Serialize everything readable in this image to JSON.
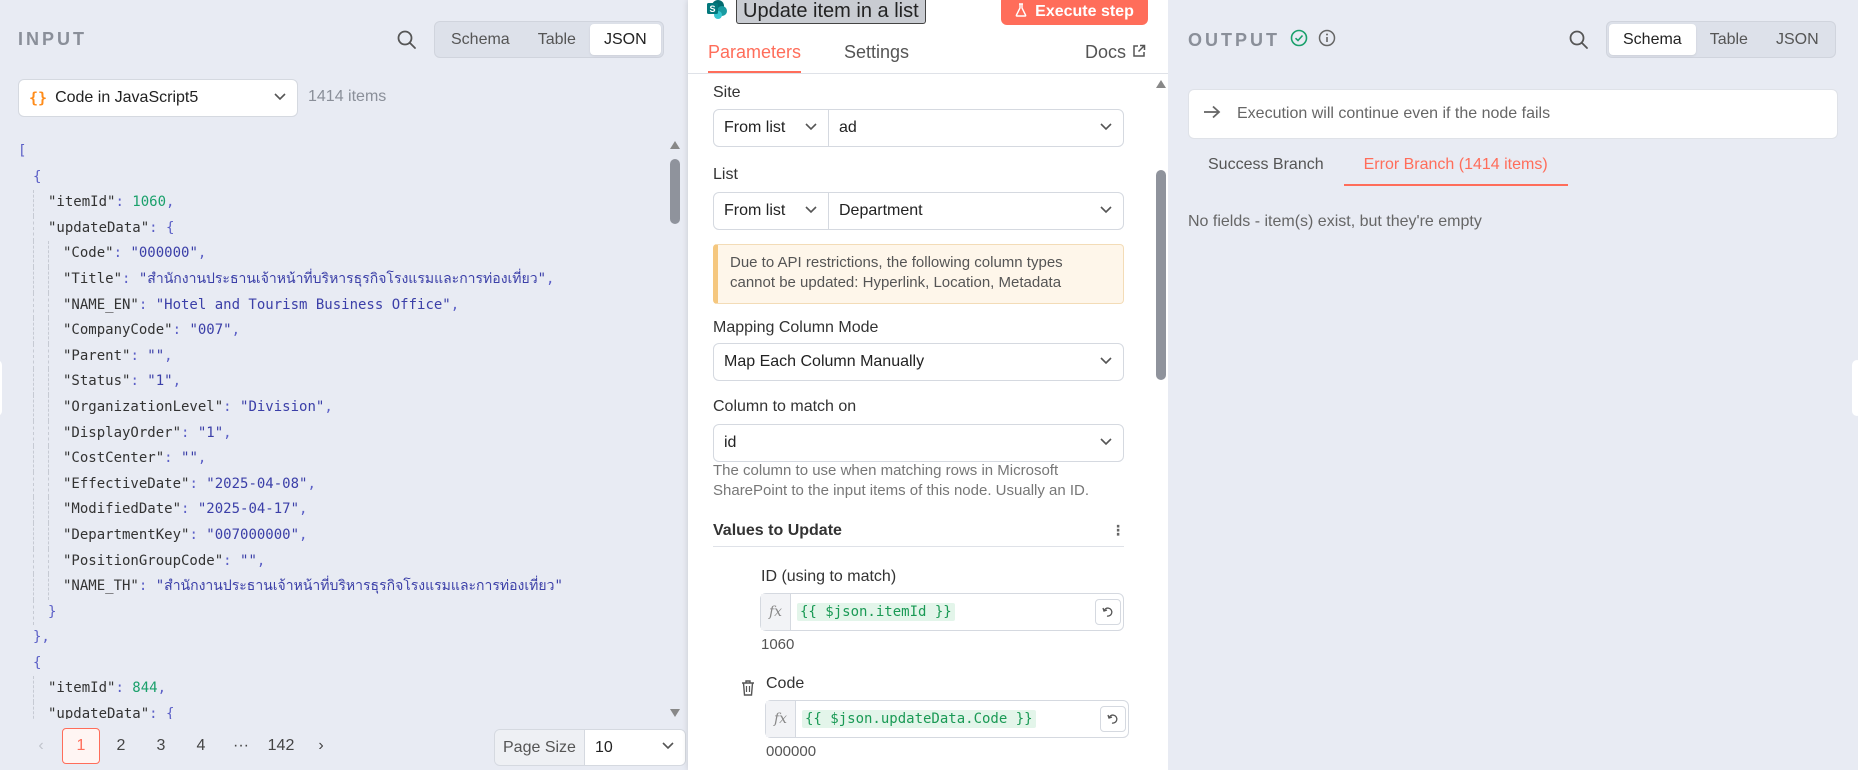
{
  "input": {
    "title": "INPUT",
    "view_tabs": [
      "Schema",
      "Table",
      "JSON"
    ],
    "active_view": "JSON",
    "node_select": "Code in JavaScript5",
    "items_count": "1414 items",
    "json_lines": [
      {
        "indent": 0,
        "parts": [
          [
            "pun",
            "["
          ]
        ]
      },
      {
        "indent": 1,
        "parts": [
          [
            "pun",
            "{"
          ]
        ]
      },
      {
        "indent": 2,
        "parts": [
          [
            "key",
            "\"itemId\""
          ],
          [
            "pun",
            ": "
          ],
          [
            "num",
            "1060"
          ],
          [
            "pun",
            ","
          ]
        ]
      },
      {
        "indent": 2,
        "parts": [
          [
            "key",
            "\"updateData\""
          ],
          [
            "pun",
            ": {"
          ]
        ]
      },
      {
        "indent": 3,
        "parts": [
          [
            "key",
            "\"Code\""
          ],
          [
            "pun",
            ": "
          ],
          [
            "str",
            "\"000000\""
          ],
          [
            "pun",
            ","
          ]
        ]
      },
      {
        "indent": 3,
        "parts": [
          [
            "key",
            "\"Title\""
          ],
          [
            "pun",
            ": "
          ],
          [
            "str",
            "\"สำนักงานประธานเจ้าหน้าที่บริหารธุรกิจโรงแรมและการท่องเที่ยว\""
          ],
          [
            "pun",
            ","
          ]
        ]
      },
      {
        "indent": 3,
        "parts": [
          [
            "key",
            "\"NAME_EN\""
          ],
          [
            "pun",
            ": "
          ],
          [
            "str",
            "\"Hotel and Tourism Business Office\""
          ],
          [
            "pun",
            ","
          ]
        ]
      },
      {
        "indent": 3,
        "parts": [
          [
            "key",
            "\"CompanyCode\""
          ],
          [
            "pun",
            ": "
          ],
          [
            "str",
            "\"007\""
          ],
          [
            "pun",
            ","
          ]
        ]
      },
      {
        "indent": 3,
        "parts": [
          [
            "key",
            "\"Parent\""
          ],
          [
            "pun",
            ": "
          ],
          [
            "str",
            "\"\""
          ],
          [
            "pun",
            ","
          ]
        ]
      },
      {
        "indent": 3,
        "parts": [
          [
            "key",
            "\"Status\""
          ],
          [
            "pun",
            ": "
          ],
          [
            "str",
            "\"1\""
          ],
          [
            "pun",
            ","
          ]
        ]
      },
      {
        "indent": 3,
        "parts": [
          [
            "key",
            "\"OrganizationLevel\""
          ],
          [
            "pun",
            ": "
          ],
          [
            "str",
            "\"Division\""
          ],
          [
            "pun",
            ","
          ]
        ]
      },
      {
        "indent": 3,
        "parts": [
          [
            "key",
            "\"DisplayOrder\""
          ],
          [
            "pun",
            ": "
          ],
          [
            "str",
            "\"1\""
          ],
          [
            "pun",
            ","
          ]
        ]
      },
      {
        "indent": 3,
        "parts": [
          [
            "key",
            "\"CostCenter\""
          ],
          [
            "pun",
            ": "
          ],
          [
            "str",
            "\"\""
          ],
          [
            "pun",
            ","
          ]
        ]
      },
      {
        "indent": 3,
        "parts": [
          [
            "key",
            "\"EffectiveDate\""
          ],
          [
            "pun",
            ": "
          ],
          [
            "str",
            "\"2025-04-08\""
          ],
          [
            "pun",
            ","
          ]
        ]
      },
      {
        "indent": 3,
        "parts": [
          [
            "key",
            "\"ModifiedDate\""
          ],
          [
            "pun",
            ": "
          ],
          [
            "str",
            "\"2025-04-17\""
          ],
          [
            "pun",
            ","
          ]
        ]
      },
      {
        "indent": 3,
        "parts": [
          [
            "key",
            "\"DepartmentKey\""
          ],
          [
            "pun",
            ": "
          ],
          [
            "str",
            "\"007000000\""
          ],
          [
            "pun",
            ","
          ]
        ]
      },
      {
        "indent": 3,
        "parts": [
          [
            "key",
            "\"PositionGroupCode\""
          ],
          [
            "pun",
            ": "
          ],
          [
            "str",
            "\"\""
          ],
          [
            "pun",
            ","
          ]
        ]
      },
      {
        "indent": 3,
        "parts": [
          [
            "key",
            "\"NAME_TH\""
          ],
          [
            "pun",
            ": "
          ],
          [
            "str",
            "\"สำนักงานประธานเจ้าหน้าที่บริหารธุรกิจโรงแรมและการท่องเที่ยว\""
          ]
        ]
      },
      {
        "indent": 2,
        "parts": [
          [
            "pun",
            "}"
          ]
        ]
      },
      {
        "indent": 1,
        "parts": [
          [
            "pun",
            "},"
          ]
        ]
      },
      {
        "indent": 1,
        "parts": [
          [
            "pun",
            "{"
          ]
        ]
      },
      {
        "indent": 2,
        "parts": [
          [
            "key",
            "\"itemId\""
          ],
          [
            "pun",
            ": "
          ],
          [
            "num",
            "844"
          ],
          [
            "pun",
            ","
          ]
        ]
      },
      {
        "indent": 2,
        "parts": [
          [
            "key",
            "\"updateData\""
          ],
          [
            "pun",
            ": {"
          ]
        ]
      }
    ],
    "pager": {
      "prev": "‹",
      "pages": [
        "1",
        "2",
        "3",
        "4",
        "···",
        "142"
      ],
      "active": "1",
      "next": "›"
    },
    "page_size": {
      "label": "Page Size",
      "value": "10"
    }
  },
  "node": {
    "name": "Update item in a list",
    "execute_label": "Execute step",
    "tabs": [
      "Parameters",
      "Settings"
    ],
    "active_tab": "Parameters",
    "docs_label": "Docs",
    "site": {
      "label": "Site",
      "mode": "From list",
      "value": "ad"
    },
    "list": {
      "label": "List",
      "mode": "From list",
      "value": "Department"
    },
    "notice": "Due to API restrictions, the following column types cannot be updated: Hyperlink, Location, Metadata",
    "mapping": {
      "label": "Mapping Column Mode",
      "value": "Map Each Column Manually"
    },
    "match": {
      "label": "Column to match on",
      "value": "id",
      "hint": "The column to use when matching rows in Microsoft SharePoint to the input items of this node. Usually an ID."
    },
    "values_heading": "Values to Update",
    "more_glyph": "⋮",
    "fields": [
      {
        "label": "ID (using to match)",
        "expression": "{{ $json.itemId }}",
        "result": "1060"
      },
      {
        "label": "Code",
        "expression": "{{ $json.updateData.Code }}",
        "result": "000000"
      }
    ],
    "fx_label": "fx"
  },
  "output": {
    "title": "OUTPUT",
    "view_tabs": [
      "Schema",
      "Table",
      "JSON"
    ],
    "active_view": "Schema",
    "warning": "Execution will continue even if the node fails",
    "branches": [
      "Success Branch",
      "Error Branch (1414 items)"
    ],
    "active_branch": "Error Branch (1414 items)",
    "empty_message": "No fields - item(s) exist, but they're empty"
  },
  "colors": {
    "accent": "#ff6d5a",
    "success": "#1aa06b",
    "panel_bg": "#e8ebf3"
  }
}
